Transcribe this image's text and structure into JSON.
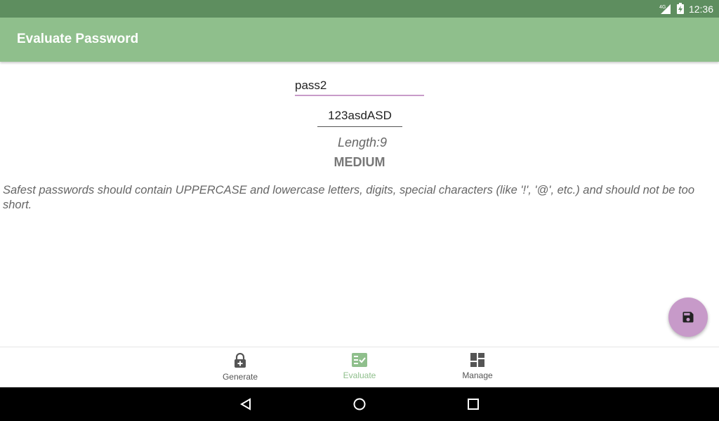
{
  "status_bar": {
    "network": "4G",
    "time": "12:36"
  },
  "app_bar": {
    "title": "Evaluate Password"
  },
  "form": {
    "name_value": "pass2",
    "password_value": "123asdASD",
    "length_text": "Length:9",
    "strength": "MEDIUM",
    "hint": "Safest passwords should contain UPPERCASE and lowercase letters, digits, special characters (like '!', '@', etc.) and should not be too short."
  },
  "fab": {
    "icon": "save-icon",
    "color": "#c79ac9"
  },
  "bottom_nav": {
    "items": [
      {
        "label": "Generate",
        "icon": "lock-add-icon",
        "active": false
      },
      {
        "label": "Evaluate",
        "icon": "checklist-icon",
        "active": true
      },
      {
        "label": "Manage",
        "icon": "dashboard-icon",
        "active": false
      }
    ],
    "active_color": "#8fbf8c",
    "inactive_color": "#555555"
  },
  "colors": {
    "status_bar": "#5e8e5f",
    "app_bar": "#8fbf8c",
    "accent": "#c79ac9"
  }
}
